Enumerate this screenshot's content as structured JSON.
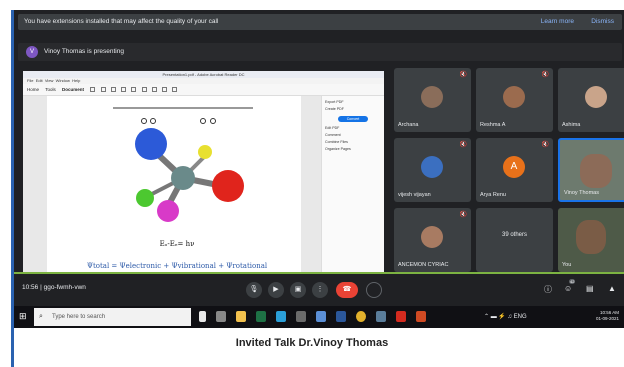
{
  "notification": {
    "text": "You have extensions installed that may affect the quality of your call",
    "learn_more": "Learn more",
    "dismiss": "Dismiss"
  },
  "presenting": {
    "avatar_letter": "V",
    "text": "Vinoy Thomas is presenting"
  },
  "shared_document": {
    "window_title": "Presentation1.pdf - Adobe Acrobat Reader DC",
    "menu": [
      "File",
      "Edit",
      "View",
      "Window",
      "Help"
    ],
    "tabs": [
      "Home",
      "Tools",
      "Document"
    ],
    "energy_equation": "Eₒ-Eₑ= hν",
    "psi_equation": "Ψtotal = Ψelectronic + Ψvibrational + Ψrotational",
    "side_panel": [
      "Export PDF",
      "Create PDF",
      "Edit PDF",
      "Comment",
      "Combine Files",
      "Organize Pages"
    ],
    "convert_button": "Convert"
  },
  "participants": [
    {
      "name": "Archana",
      "type": "photo"
    },
    {
      "name": "Reshma A",
      "type": "photo"
    },
    {
      "name": "Ashima",
      "type": "photo"
    },
    {
      "name": "vijesh vijayan",
      "type": "photo"
    },
    {
      "name": "Arya Renu",
      "type": "letter",
      "letter": "A"
    },
    {
      "name": "Vinoy Thomas",
      "type": "video"
    },
    {
      "name": "ANCEMON CYRIAC",
      "type": "photo"
    },
    {
      "name": "",
      "type": "others",
      "others_text": "39 others"
    },
    {
      "name": "You",
      "type": "video"
    }
  ],
  "meeting": {
    "time": "10:56",
    "separator": "|",
    "code": "ggo-fwmh-vwn",
    "participant_count": "42"
  },
  "taskbar": {
    "search_placeholder": "Type here to search",
    "time": "10:56 AM",
    "date": "01-09-2021",
    "lang": "ENG"
  },
  "caption": "Invited Talk Dr.Vinoy Thomas",
  "colors": {
    "end_call": "#ea4335",
    "accent": "#1a73e8",
    "panel_bg": "#202124"
  }
}
